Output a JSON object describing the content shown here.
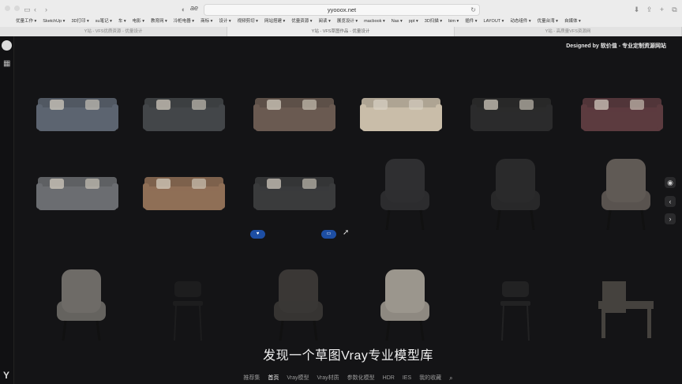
{
  "browser": {
    "url": "yyooox.net",
    "ae_label": "ae",
    "bookmarks": [
      "优量工作 ▾",
      "SketchUp ▾",
      "3D打印 ▾",
      "su笔记 ▾",
      "车 ▾",
      "电影 ▾",
      "教育网 ▾",
      "冷柜电器 ▾",
      "商标 ▾",
      "设计 ▾",
      "视频剪切 ▾",
      "网站搭建 ▾",
      "优量资源 ▾",
      "阅读 ▾",
      "展览设计 ▾",
      "macbook ▾",
      "Nas ▾",
      "ppt ▾",
      "3D扫描 ▾",
      "bim ▾",
      "插件 ▾",
      "LAYOUT ▾",
      "动态组件 ▾",
      "优量台湾 ▾",
      "自媒体 ▾"
    ],
    "tabs": [
      "Y站 - VFS优质资源 - 优量设计",
      "Y站 - VFS草图作品 - 优量设计",
      "Y站 - 高质量VFS资源网"
    ]
  },
  "site": {
    "designed_by": "Designed by 软价值 - 专业定制资源网站",
    "subtitle": "发现一个草图Vray专业模型库",
    "footer_nav": [
      "推荐集",
      "首页",
      "Vray模型",
      "Vray材质",
      "参数化模型",
      "HDR",
      "IES",
      "我的收藏"
    ],
    "active_nav": "首页"
  },
  "models": [
    {
      "name": "grey-sectional-sofa",
      "color": "#5c6470"
    },
    {
      "name": "dark-grey-sofa",
      "color": "#434649"
    },
    {
      "name": "brown-sofa",
      "color": "#6a5a51"
    },
    {
      "name": "cream-l-sofa",
      "color": "#c9bda9"
    },
    {
      "name": "black-leather-sofa",
      "color": "#2b2b2c"
    },
    {
      "name": "maroon-sectional-sofa",
      "color": "#5c3b3f"
    },
    {
      "name": "grey-fabric-sofa",
      "color": "#6b6d71"
    },
    {
      "name": "tan-sofa",
      "color": "#8f6f56"
    },
    {
      "name": "black-sofa-wood-frame",
      "color": "#3a3b3c"
    },
    {
      "name": "black-lounge-chair",
      "color": "#2f2f31"
    },
    {
      "name": "black-armchair",
      "color": "#2a2a2b"
    },
    {
      "name": "grey-curved-chair",
      "color": "#605a55"
    },
    {
      "name": "grey-tub-chair",
      "color": "#6e6b67"
    },
    {
      "name": "black-bar-stool",
      "color": "#1d1d1e"
    },
    {
      "name": "dark-lounge-chair",
      "color": "#3a3735"
    },
    {
      "name": "white-dining-chair",
      "color": "#9b968d"
    },
    {
      "name": "black-dining-chair",
      "color": "#222223"
    },
    {
      "name": "dark-side-table",
      "color": "#45423e"
    }
  ],
  "icons": {
    "heart": "heart-icon",
    "folder": "folder-icon",
    "search": "search-icon",
    "chevron_left": "chevron-left-icon",
    "chevron_right": "chevron-right-icon"
  }
}
